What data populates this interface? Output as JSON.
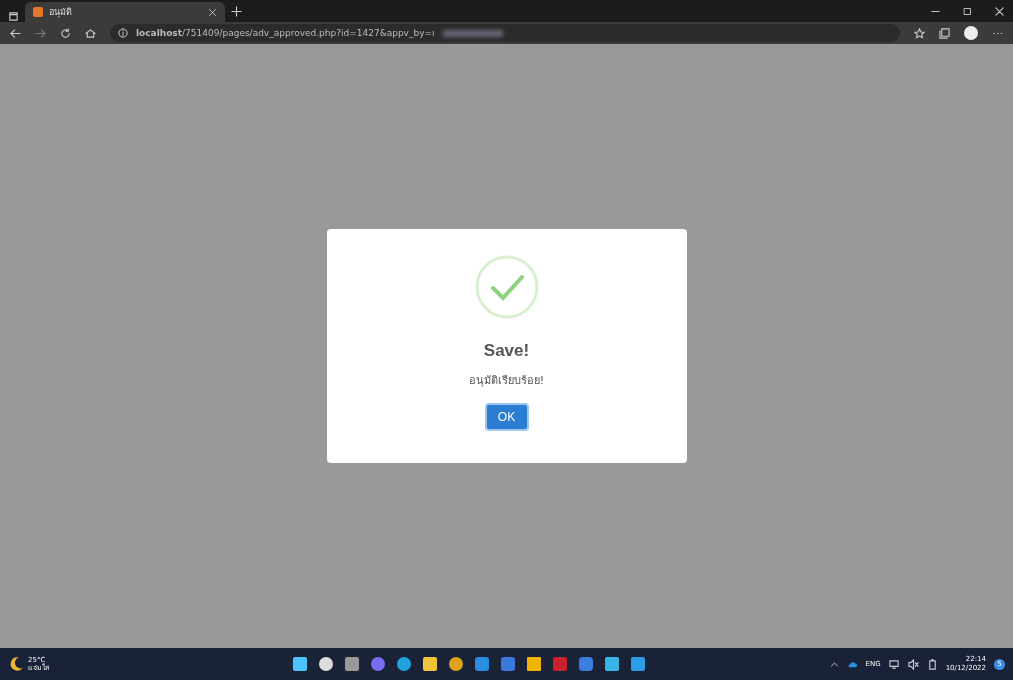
{
  "browser": {
    "tab": {
      "title": "อนุมัติ",
      "selected": true
    },
    "address": "**localhost**/751409/pages/adv_approved.php?id=1427&appv_by=ı"
  },
  "dialog": {
    "title": "Save!",
    "message": "อนุมัติเรียบร้อย!",
    "button": "OK"
  },
  "taskbar": {
    "weather": {
      "temperature": "25°C",
      "condition": "แจ่มใส"
    },
    "language": "ENG",
    "time": "22:14",
    "date": "10/12/2022",
    "badge": "5"
  }
}
